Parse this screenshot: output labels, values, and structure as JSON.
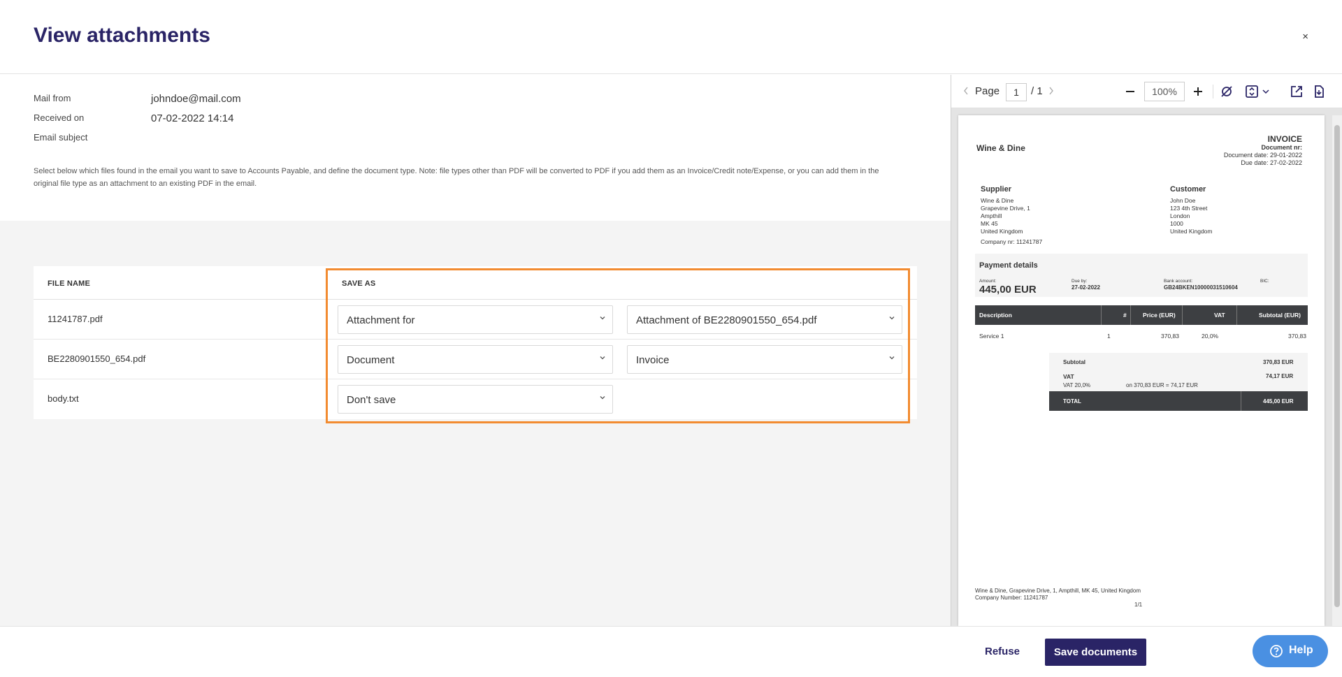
{
  "header": {
    "title": "View attachments",
    "close_label": "×"
  },
  "meta": {
    "mail_from_label": "Mail from",
    "mail_from_value": "johndoe@mail.com",
    "received_label": "Received on",
    "received_value": "07-02-2022 14:14",
    "subject_label": "Email subject",
    "instructions": "Select below which files found in the email you want to save to Accounts Payable, and define the document type. Note: file types other than PDF will be converted to PDF if you add them as an Invoice/Credit note/Expense, or you can add them in the original file type as an attachment to an existing PDF in the email."
  },
  "table": {
    "col_file": "FILE NAME",
    "col_save": "SAVE AS",
    "rows": [
      {
        "file": "11241787.pdf",
        "save_as": "Attachment for",
        "target": "Attachment of BE2280901550_654.pdf"
      },
      {
        "file": "BE2280901550_654.pdf",
        "save_as": "Document",
        "target": "Invoice"
      },
      {
        "file": "body.txt",
        "save_as": "Don't save"
      }
    ]
  },
  "viewer": {
    "page_label": "Page",
    "page_current": "1",
    "page_total": "/ 1",
    "zoom": "100%",
    "document": {
      "company": "Wine & Dine",
      "doc_title": "INVOICE",
      "doc_nr_label": "Document nr:",
      "doc_date": "Document date: 29-01-2022",
      "due_date": "Due date: 27-02-2022",
      "supplier_label": "Supplier",
      "supplier_lines": [
        "Wine & Dine",
        "Grapevine Drive, 1",
        "Ampthill",
        "MK 45",
        "United Kingdom"
      ],
      "company_nr": "Company nr: 11241787",
      "customer_label": "Customer",
      "customer_lines": [
        "John Doe",
        "123 4th Street",
        "London",
        "1000",
        "United Kingdom"
      ],
      "payment_label": "Payment details",
      "amount_label": "Amount:",
      "amount_value": "445,00 EUR",
      "due_by_label": "Due by:",
      "due_by_value": "27-02-2022",
      "bank_label": "Bank account:",
      "bank_value": "GB24BKEN10000031510604",
      "bic_label": "BIC:",
      "th_desc": "Description",
      "th_num": "#",
      "th_price": "Price (EUR)",
      "th_vat": "VAT",
      "th_subtotal": "Subtotal (EUR)",
      "line_desc": "Service 1",
      "line_num": "1",
      "line_price": "370,83",
      "line_vat": "20,0%",
      "line_subtotal": "370,83",
      "subtotal_label": "Subtotal",
      "subtotal_value": "370,83 EUR",
      "vat_label": "VAT",
      "vat_value": "74,17 EUR",
      "vat_rate": "VAT 20,0%",
      "vat_calc": "on 370,83 EUR = 74,17 EUR",
      "total_label": "TOTAL",
      "total_value": "445,00 EUR",
      "footer_address": "Wine & Dine, Grapevine Drive, 1,   Ampthill,  MK 45, United Kingdom",
      "footer_company": "Company Number: 11241787",
      "footer_page": "1/1"
    }
  },
  "footer": {
    "refuse_label": "Refuse",
    "save_label": "Save documents",
    "help_label": "Help"
  },
  "colors": {
    "brand": "#2a2466",
    "highlight": "#f28b30",
    "help": "#4a90e2",
    "doc_dark": "#3d3f42"
  }
}
